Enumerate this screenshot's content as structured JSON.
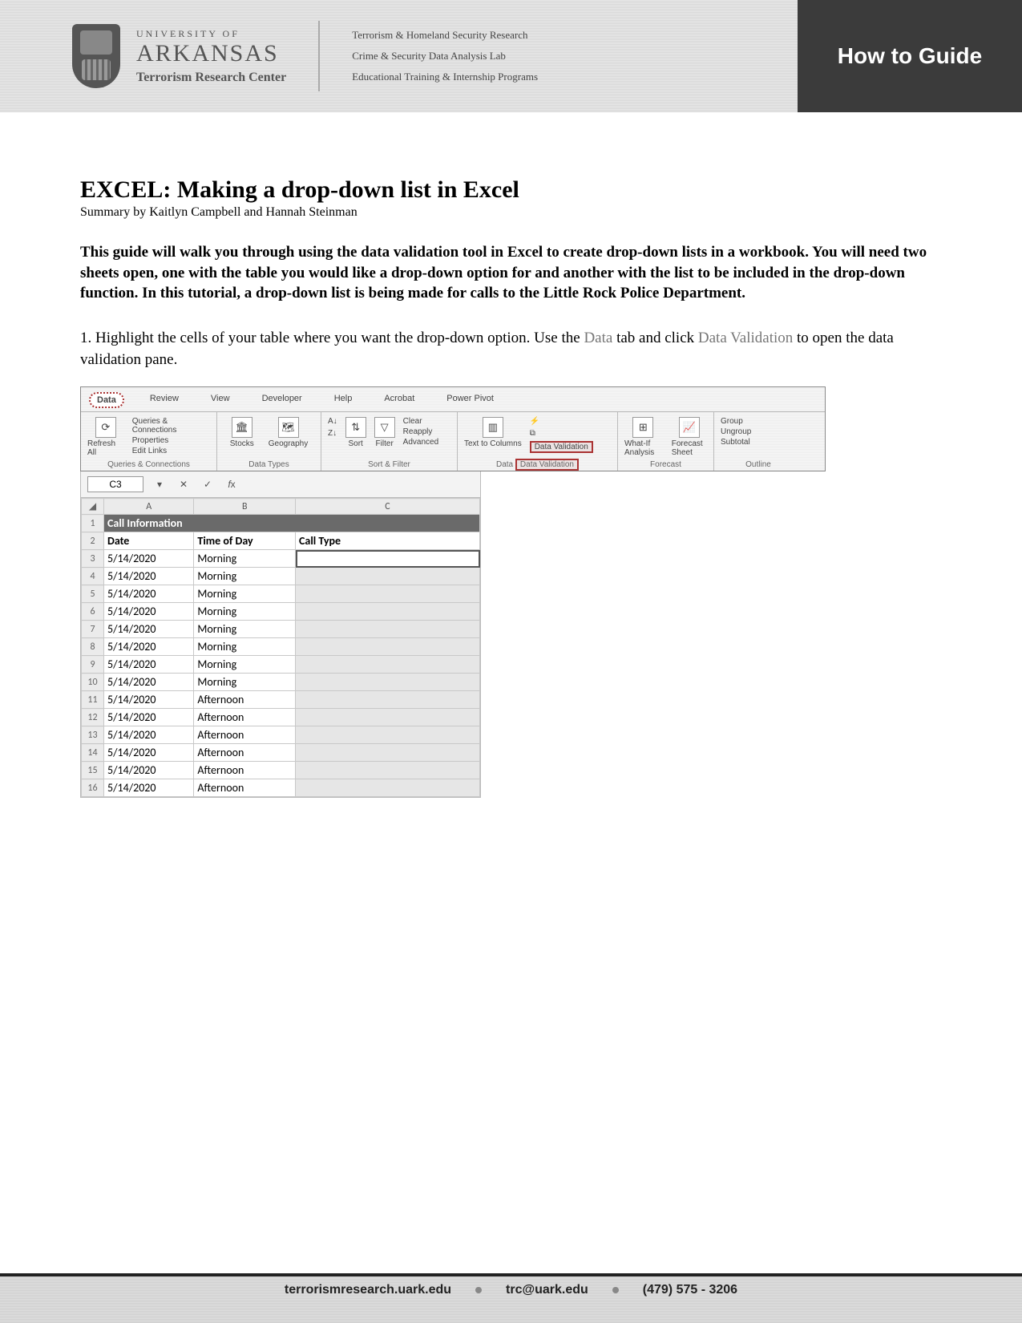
{
  "header": {
    "university_top": "UNIVERSITY OF",
    "university": "ARKANSAS",
    "center": "Terrorism Research Center",
    "lines": {
      "l1": "Terrorism & Homeland Security Research",
      "l2": "Crime & Security Data Analysis Lab",
      "l3": "Educational Training & Internship Programs"
    },
    "badge": "How to Guide"
  },
  "doc": {
    "title": "EXCEL: Making a drop-down list in Excel",
    "byline": "Summary by Kaitlyn Campbell and Hannah Steinman",
    "intro": "This guide will walk you through using the data validation tool in Excel to create drop-down lists in a workbook. You will need two sheets open, one with the table you would like a drop-down option for and another with the list to be included in the drop-down function. In this tutorial, a drop-down list is being made for calls to the Little Rock Police Department.",
    "step1_pre": "1. Highlight the cells of your table where you want the drop-down option. Use the ",
    "step1_data": "Data",
    "step1_mid": " tab and click ",
    "step1_dv": "Data Validation",
    "step1_post": " to open the data validation pane."
  },
  "ribbon": {
    "tabs": [
      "Data",
      "Review",
      "View",
      "Developer",
      "Help",
      "Acrobat",
      "Power Pivot"
    ],
    "groups": {
      "queries": {
        "label": "Queries & Connections",
        "items": [
          "Queries & Connections",
          "Properties",
          "Edit Links"
        ],
        "left": "Refresh All"
      },
      "datatypes": {
        "label": "Data Types",
        "items": [
          "Stocks",
          "Geography"
        ]
      },
      "sortfilter": {
        "label": "Sort & Filter",
        "sort": "Sort",
        "filter": "Filter",
        "opts": [
          "Clear",
          "Reapply",
          "Advanced"
        ]
      },
      "datatools": {
        "label": "Data Tools",
        "ttc": "Text to Columns",
        "dv": "Data Validation"
      },
      "forecast": {
        "label": "Forecast",
        "items": [
          "What-If Analysis",
          "Forecast Sheet"
        ]
      },
      "outline": {
        "label": "Outline",
        "items": [
          "Group",
          "Ungroup",
          "Subtotal"
        ]
      }
    }
  },
  "sheet": {
    "activeCell": "C3",
    "cols": [
      "A",
      "B",
      "C"
    ],
    "mergedHeader": "Call Information",
    "headers": {
      "A": "Date",
      "B": "Time of Day",
      "C": "Call Type"
    },
    "rows": [
      {
        "n": 3,
        "date": "5/14/2020",
        "tod": "Morning"
      },
      {
        "n": 4,
        "date": "5/14/2020",
        "tod": "Morning"
      },
      {
        "n": 5,
        "date": "5/14/2020",
        "tod": "Morning"
      },
      {
        "n": 6,
        "date": "5/14/2020",
        "tod": "Morning"
      },
      {
        "n": 7,
        "date": "5/14/2020",
        "tod": "Morning"
      },
      {
        "n": 8,
        "date": "5/14/2020",
        "tod": "Morning"
      },
      {
        "n": 9,
        "date": "5/14/2020",
        "tod": "Morning"
      },
      {
        "n": 10,
        "date": "5/14/2020",
        "tod": "Morning"
      },
      {
        "n": 11,
        "date": "5/14/2020",
        "tod": "Afternoon"
      },
      {
        "n": 12,
        "date": "5/14/2020",
        "tod": "Afternoon"
      },
      {
        "n": 13,
        "date": "5/14/2020",
        "tod": "Afternoon"
      },
      {
        "n": 14,
        "date": "5/14/2020",
        "tod": "Afternoon"
      },
      {
        "n": 15,
        "date": "5/14/2020",
        "tod": "Afternoon"
      },
      {
        "n": 16,
        "date": "5/14/2020",
        "tod": "Afternoon"
      }
    ]
  },
  "footer": {
    "site": "terrorismresearch.uark.edu",
    "email": "trc@uark.edu",
    "phone": "(479) 575 - 3206"
  }
}
